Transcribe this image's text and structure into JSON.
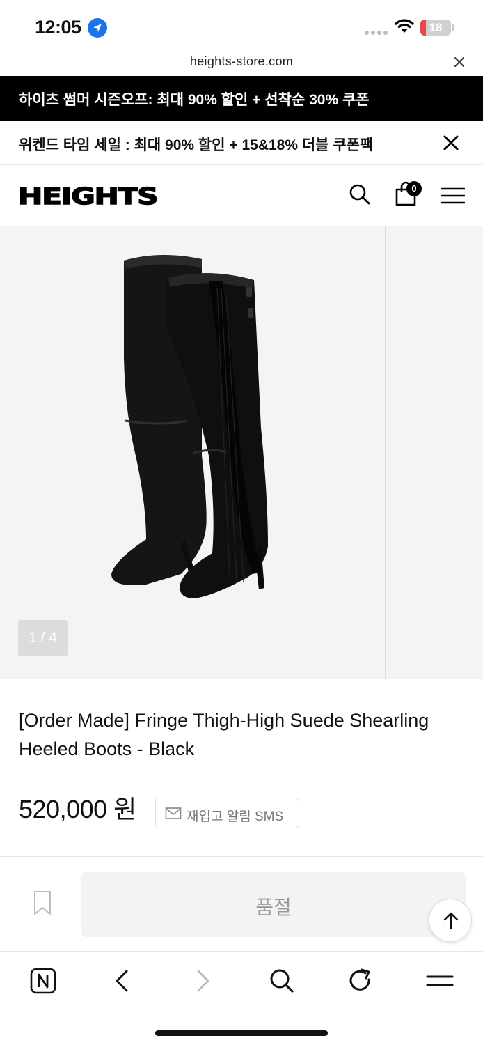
{
  "status_bar": {
    "time": "12:05",
    "battery": "18",
    "battery_percent": 18
  },
  "browser": {
    "url": "heights-store.com"
  },
  "promo": {
    "banner_top": "하이츠 썸머 시즌오프: 최대 90% 할인 + 선착순 30% 쿠폰",
    "banner_sub": "위켄드 타임 세일 : 최대 90% 할인 + 15&18% 더블 쿠폰팩"
  },
  "header": {
    "logo": "HEIGHTS",
    "cart_count": "0"
  },
  "gallery": {
    "counter": "1 / 4"
  },
  "product": {
    "title": "[Order Made] Fringe Thigh-High Suede Shearling Heeled Boots - Black",
    "price": "520,000 원",
    "restock_label": "재입고 알림 SMS",
    "soldout_label": "품절"
  },
  "colors": {
    "accent": "#000000",
    "location_blue": "#1a73e8",
    "battery_red": "#e5484d"
  },
  "icons": {
    "status": [
      "location-icon",
      "signal-icon",
      "wifi-icon",
      "battery-icon"
    ],
    "header": [
      "search-icon",
      "cart-icon",
      "menu-icon"
    ],
    "toolbar": [
      "naver-home-icon",
      "back-icon",
      "forward-icon",
      "search-icon",
      "reload-icon",
      "menu-icon"
    ]
  }
}
